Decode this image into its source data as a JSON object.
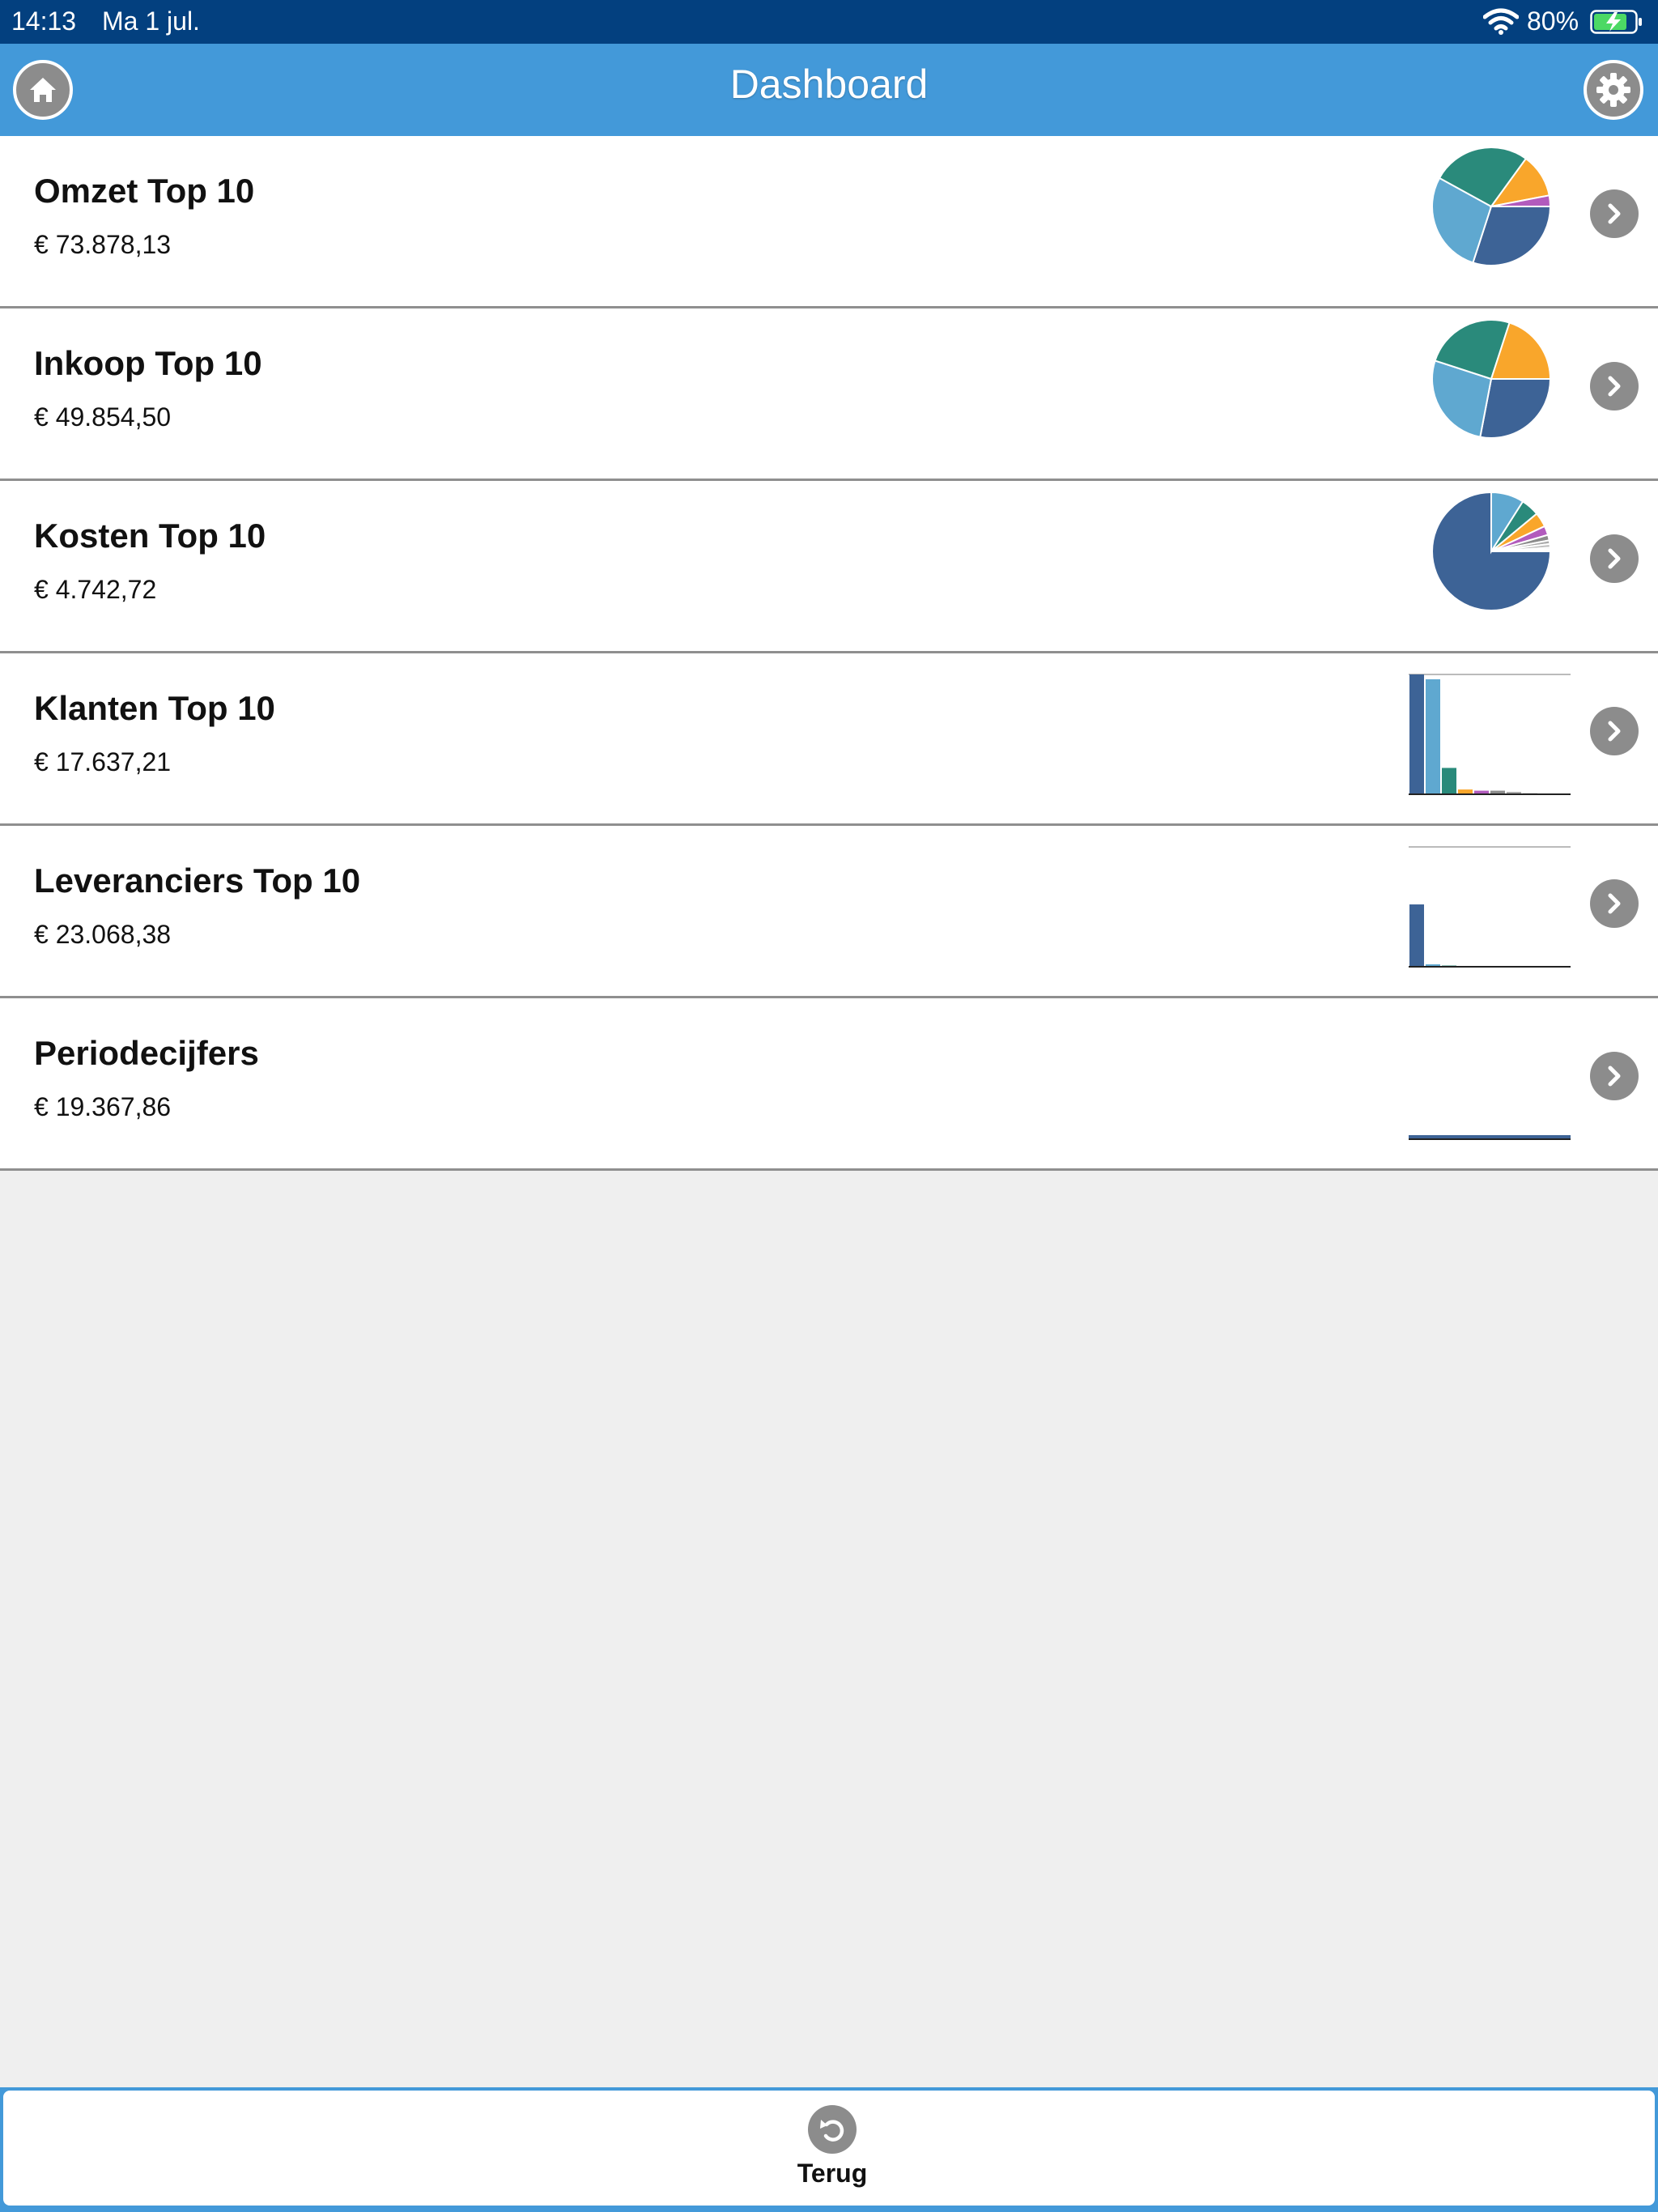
{
  "status_bar": {
    "time": "14:13",
    "date": "Ma 1 jul.",
    "battery_percent": "80%",
    "wifi_icon": "wifi-icon",
    "battery_icon": "battery-charging-icon"
  },
  "header": {
    "title": "Dashboard",
    "home_icon": "home-icon",
    "settings_icon": "gear-icon"
  },
  "colors": {
    "status_bar_bg": "#03407f",
    "header_bg": "#4399d9",
    "dark_blue": "#3d6396",
    "light_blue": "#5fa8d0",
    "teal": "#2a8a7b",
    "orange": "#f9a62b",
    "purple": "#b25bbd",
    "grey": "#8c8c8c"
  },
  "rows": [
    {
      "name": "Omzet Top 10",
      "amount": "€ 73.878,13"
    },
    {
      "name": "Inkoop Top 10",
      "amount": "€ 49.854,50"
    },
    {
      "name": "Kosten Top 10",
      "amount": "€ 4.742,72"
    },
    {
      "name": "Klanten Top 10",
      "amount": "€ 17.637,21"
    },
    {
      "name": "Leveranciers Top 10",
      "amount": "€ 23.068,38"
    },
    {
      "name": "Periodecijfers",
      "amount": "€ 19.367,86"
    }
  ],
  "chart_data": [
    {
      "type": "pie",
      "series": [
        {
          "values": [
            30,
            28,
            27,
            12,
            3
          ]
        }
      ],
      "colors": [
        "#3d6396",
        "#5fa8d0",
        "#2a8a7b",
        "#f9a62b",
        "#b25bbd"
      ]
    },
    {
      "type": "pie",
      "series": [
        {
          "values": [
            28,
            27,
            25,
            20
          ]
        }
      ],
      "colors": [
        "#3d6396",
        "#5fa8d0",
        "#2a8a7b",
        "#f9a62b"
      ]
    },
    {
      "type": "pie",
      "series": [
        {
          "values": [
            75,
            9,
            5,
            4,
            2.5,
            1.5,
            1,
            1,
            0.5,
            0.5
          ]
        }
      ],
      "colors": [
        "#3d6396",
        "#5fa8d0",
        "#2a8a7b",
        "#f9a62b",
        "#b25bbd",
        "#8c8c8c",
        "#aaaaaa",
        "#c0c0c0",
        "#d0d0d0",
        "#e0e0e0"
      ]
    },
    {
      "type": "bar",
      "series": [
        {
          "values": [
            100,
            96,
            22,
            4,
            3,
            3,
            2,
            1,
            0.5,
            0.5
          ]
        }
      ],
      "colors": [
        "#3d6396",
        "#5fa8d0",
        "#2a8a7b",
        "#f9a62b",
        "#b25bbd",
        "#8c8c8c",
        "#aaaaaa",
        "#c0c0c0",
        "#d0d0d0",
        "#e0e0e0"
      ],
      "ylim": [
        0,
        100
      ],
      "grid": true
    },
    {
      "type": "bar",
      "series": [
        {
          "values": [
            52,
            2,
            1,
            0.5,
            0.3,
            0.2,
            0.1,
            0.1,
            0.1,
            0.1
          ]
        }
      ],
      "colors": [
        "#3d6396",
        "#5fa8d0",
        "#2a8a7b",
        "#f9a62b",
        "#b25bbd",
        "#8c8c8c",
        "#aaaaaa",
        "#c0c0c0",
        "#d0d0d0",
        "#e0e0e0"
      ],
      "ylim": [
        0,
        100
      ],
      "grid": true
    },
    {
      "type": "line",
      "series": [
        {
          "values": [
            2,
            2,
            2,
            2,
            2,
            2,
            2,
            2,
            2,
            2,
            2,
            2
          ]
        }
      ],
      "colors": [
        "#3d6396"
      ],
      "ylim": [
        0,
        100
      ]
    }
  ],
  "footer": {
    "back_label": "Terug",
    "back_icon": "undo-arrow-icon"
  }
}
